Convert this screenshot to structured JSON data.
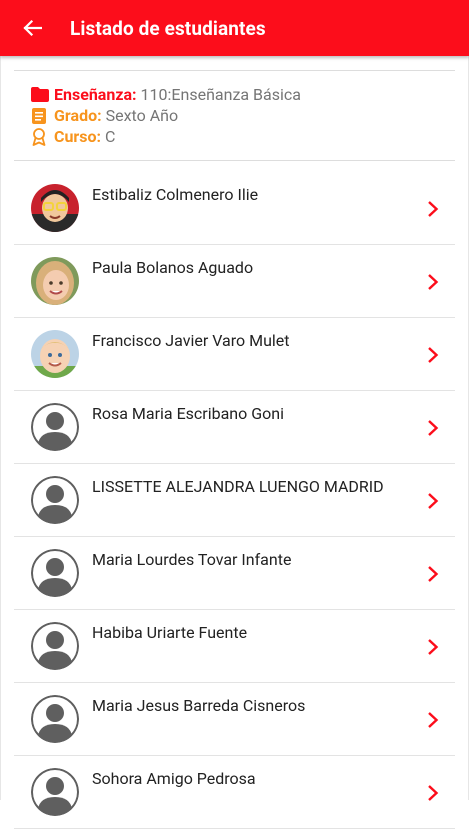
{
  "appbar": {
    "title": "Listado de estudiantes",
    "back_icon": "arrow-left-icon"
  },
  "info": {
    "ensenanza_label": "Enseñanza:",
    "ensenanza_value": "110:Enseñanza Básica",
    "grado_label": "Grado:",
    "grado_value": "Sexto Año",
    "curso_label": "Curso:",
    "curso_value": "C"
  },
  "colors": {
    "primary": "#fc0d1b",
    "orange": "#f7941d"
  },
  "students": [
    {
      "name": "Estibaliz Colmenero Ilie",
      "avatar": "photo"
    },
    {
      "name": "Paula Bolanos Aguado",
      "avatar": "photo"
    },
    {
      "name": "Francisco Javier Varo Mulet",
      "avatar": "photo"
    },
    {
      "name": "Rosa Maria Escribano Goni",
      "avatar": "placeholder"
    },
    {
      "name": "LISSETTE ALEJANDRA LUENGO MADRID",
      "avatar": "placeholder"
    },
    {
      "name": "Maria Lourdes Tovar Infante",
      "avatar": "placeholder"
    },
    {
      "name": "Habiba Uriarte Fuente",
      "avatar": "placeholder"
    },
    {
      "name": "Maria Jesus Barreda Cisneros",
      "avatar": "placeholder"
    },
    {
      "name": "Sohora Amigo Pedrosa",
      "avatar": "placeholder"
    }
  ]
}
